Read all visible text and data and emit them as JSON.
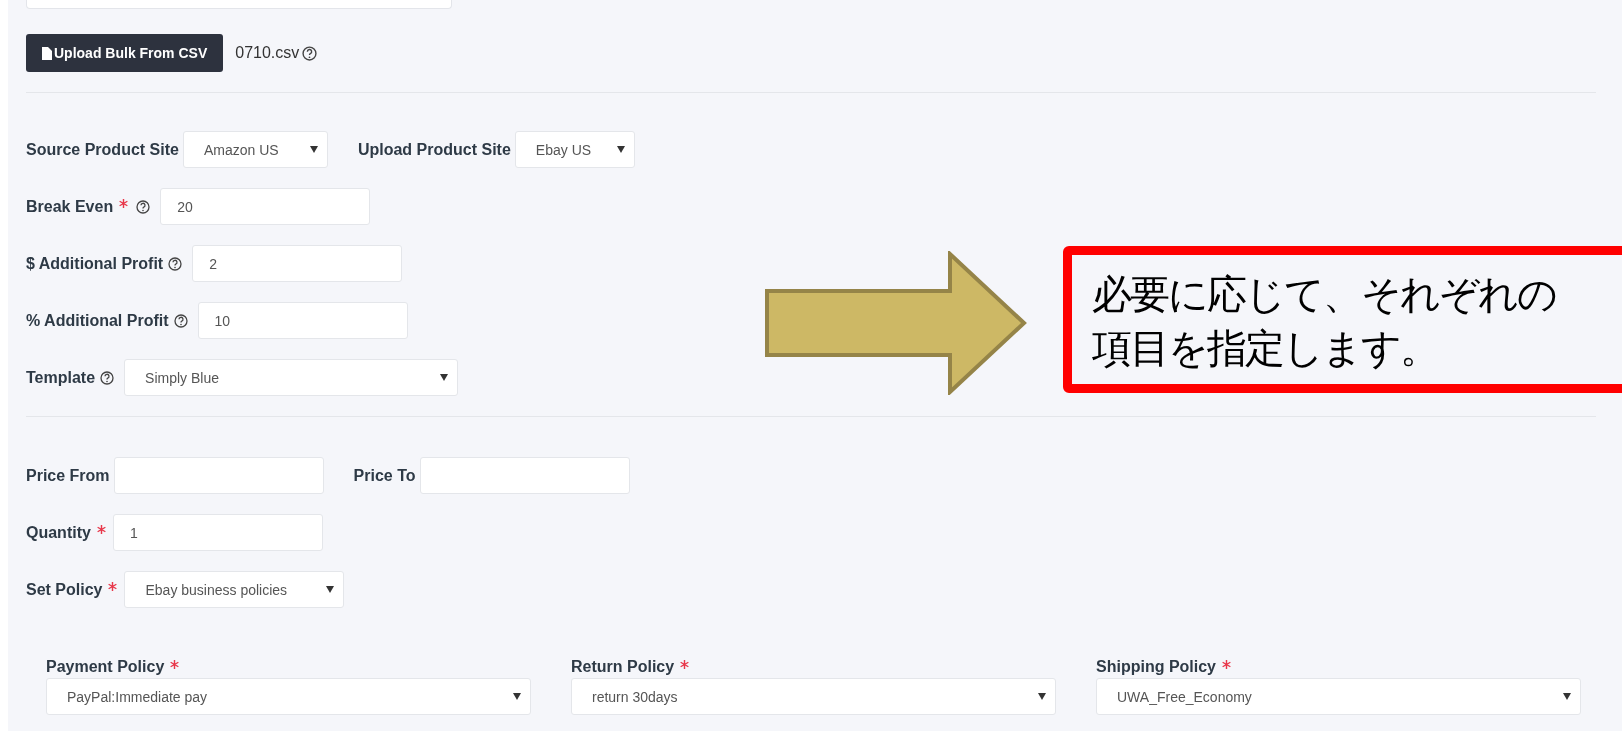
{
  "upload": {
    "button": "Upload Bulk From CSV",
    "file_name": "0710.csv"
  },
  "sites": [
    {
      "label": "Source Product Site",
      "value": "Amazon US"
    },
    {
      "label": "Upload Product Site",
      "value": "Ebay US"
    }
  ],
  "pricing": [
    {
      "label": "Break Even",
      "required": true,
      "help": true,
      "kind": "input",
      "value": "20"
    },
    {
      "label": "$ Additional Profit",
      "required": false,
      "help": true,
      "kind": "input",
      "value": "2"
    },
    {
      "label": "% Additional Profit",
      "required": false,
      "help": true,
      "kind": "input",
      "value": "10"
    },
    {
      "label": "Template",
      "required": false,
      "help": true,
      "kind": "select",
      "value": "Simply Blue"
    }
  ],
  "price_range": [
    {
      "label": "Price From"
    },
    {
      "label": "Price To"
    }
  ],
  "quantity": {
    "label": "Quantity",
    "required": true,
    "value": "1"
  },
  "set_policy": {
    "label": "Set Policy",
    "required": true,
    "value": "Ebay business policies"
  },
  "policies": [
    {
      "label": "Payment Policy",
      "required": true,
      "value": "PayPal:Immediate pay"
    },
    {
      "label": "Return Policy",
      "required": true,
      "value": "return 30days"
    },
    {
      "label": "Shipping Policy",
      "required": true,
      "value": "UWA_Free_Economy"
    }
  ],
  "callout": {
    "lines": [
      "必要に応じて、それぞれの",
      "項目を指定します。"
    ]
  }
}
